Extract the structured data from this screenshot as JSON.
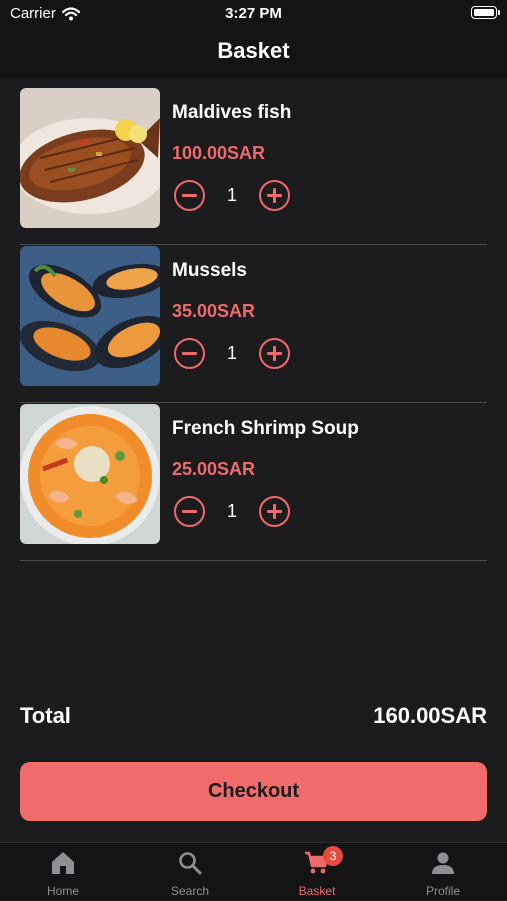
{
  "status_bar": {
    "carrier": "Carrier",
    "time": "3:27 PM"
  },
  "nav": {
    "title": "Basket"
  },
  "basket": {
    "items": [
      {
        "name": "Maldives fish",
        "price": "100.00SAR",
        "quantity": "1",
        "image": "grilled-fish"
      },
      {
        "name": "Mussels",
        "price": "35.00SAR",
        "quantity": "1",
        "image": "mussels"
      },
      {
        "name": "French Shrimp Soup",
        "price": "25.00SAR",
        "quantity": "1",
        "image": "shrimp-soup"
      }
    ]
  },
  "summary": {
    "total_label": "Total",
    "total_value": "160.00SAR"
  },
  "checkout": {
    "label": "Checkout"
  },
  "tab_bar": {
    "tabs": [
      {
        "label": "Home",
        "icon": "home-icon"
      },
      {
        "label": "Search",
        "icon": "search-icon"
      },
      {
        "label": "Basket",
        "icon": "cart-icon",
        "badge": "3",
        "active": true
      },
      {
        "label": "Profile",
        "icon": "person-icon"
      }
    ]
  },
  "colors": {
    "accent": "#ef6a6a",
    "background": "#1c1c1f",
    "bar": "#141416",
    "badge": "#e84b3c"
  }
}
